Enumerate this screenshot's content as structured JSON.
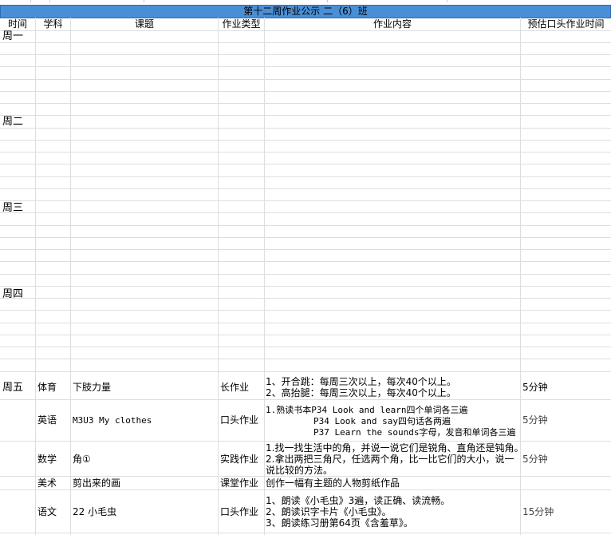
{
  "title": "第十二周作业公示 二（6）班",
  "headers": {
    "time": "时间",
    "subject": "学科",
    "topic": "课题",
    "type": "作业类型",
    "content": "作业内容",
    "duration": "预估口头作业时间"
  },
  "days": {
    "mon": "周一",
    "tue": "周二",
    "wed": "周三",
    "thu": "周四",
    "fri": "周五"
  },
  "rows": [
    {
      "subject": "体育",
      "topic": "下肢力量",
      "type": "长作业",
      "content": [
        "1、开合跳：每周三次以上，每次40个以上。",
        "2、高抬腿：每周三次以上，每次40个以上。"
      ],
      "duration": "5分钟"
    },
    {
      "subject": "英语",
      "topic": "M3U3 My clothes",
      "type": "口头作业",
      "content": [
        "1.熟读书本P34 Look and learn四个单词各三遍",
        "P34 Look and say四句话各两遍",
        "P37 Learn the sounds字母，发音和单词各三遍"
      ],
      "duration": "5分钟"
    },
    {
      "subject": "数学",
      "topic": "角①",
      "type": "实践作业",
      "content": [
        "1.找一找生活中的角，并说一说它们是锐角、直角还是钝角。",
        "2.拿出两把三角尺，任选两个角，比一比它们的大小，说一",
        "说比较的方法。"
      ],
      "duration": "5分钟"
    },
    {
      "subject": "美术",
      "topic": "剪出来的画",
      "type": "课堂作业",
      "content": [
        "创作一幅有主题的人物剪纸作品"
      ],
      "duration": ""
    },
    {
      "subject": "语文",
      "topic": "22 小毛虫",
      "type": "口头作业",
      "content": [
        "1、朗读《小毛虫》3遍，读正确、读流畅。",
        "2、朗读识字卡片《小毛虫》。",
        "3、朗读练习册第64页《含羞草》。"
      ],
      "duration": "15分钟"
    }
  ]
}
